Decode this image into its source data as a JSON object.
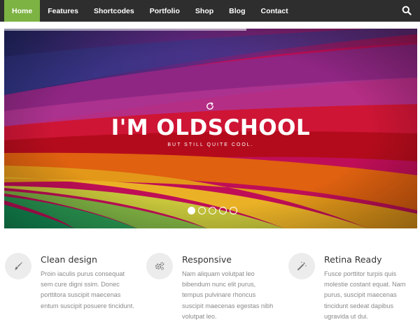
{
  "nav": {
    "items": [
      {
        "label": "Home",
        "active": true
      },
      {
        "label": "Features",
        "active": false
      },
      {
        "label": "Shortcodes",
        "active": false
      },
      {
        "label": "Portfolio",
        "active": false
      },
      {
        "label": "Shop",
        "active": false
      },
      {
        "label": "Blog",
        "active": false
      },
      {
        "label": "Contact",
        "active": false
      }
    ],
    "search_icon": "search-icon",
    "active_color": "#7cb342"
  },
  "hero": {
    "title": "I'M OLDSCHOOL",
    "subtitle": "BUT STILL QUITE COOL.",
    "slides": 5,
    "active_slide": 0,
    "icon": "reload-icon"
  },
  "features": [
    {
      "icon": "paintbrush-icon",
      "title": "Clean design",
      "text": "Proin iaculis purus consequat sem cure digni ssim. Donec porttitora suscipit maecenas entum suscipit posuere tincidunt."
    },
    {
      "icon": "gears-icon",
      "title": "Responsive",
      "text": "Nam aliquam volutpat leo bibendum nunc elit purus, tempus pulvinare rhoncus suscipit maecenas egestas nibh volutpat leo."
    },
    {
      "icon": "magic-wand-icon",
      "title": "Retina Ready",
      "text": "Fusce porttitor turpis quis molestie costant equat. Nam purus, suscipit maecenas tincidunt sedeat dapibus ugravida ut dui."
    }
  ]
}
